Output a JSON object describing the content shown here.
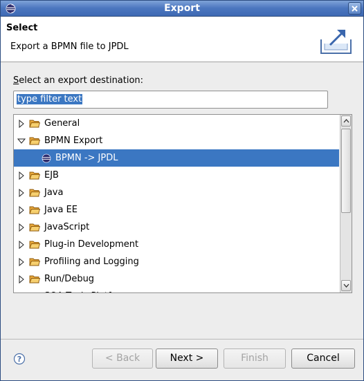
{
  "window": {
    "title": "Export"
  },
  "header": {
    "title": "Select",
    "description": "Export a BPMN file to JPDL"
  },
  "filter": {
    "label_prefix": "S",
    "label_rest": "elect an export destination:",
    "value": "type filter text"
  },
  "tree": {
    "items": [
      {
        "label": "General",
        "expanded": false,
        "icon": "folder-icon"
      },
      {
        "label": "BPMN Export",
        "expanded": true,
        "icon": "folder-open-icon"
      },
      {
        "label": "BPMN -> JPDL",
        "selected": true,
        "icon": "eclipse-icon"
      },
      {
        "label": "EJB",
        "expanded": false,
        "icon": "folder-icon"
      },
      {
        "label": "Java",
        "expanded": false,
        "icon": "folder-icon"
      },
      {
        "label": "Java EE",
        "expanded": false,
        "icon": "folder-icon"
      },
      {
        "label": "JavaScript",
        "expanded": false,
        "icon": "folder-icon"
      },
      {
        "label": "Plug-in Development",
        "expanded": false,
        "icon": "folder-icon"
      },
      {
        "label": "Profiling and Logging",
        "expanded": false,
        "icon": "folder-icon"
      },
      {
        "label": "Run/Debug",
        "expanded": false,
        "icon": "folder-icon"
      },
      {
        "label": "SOA Tools Platform",
        "expanded": false,
        "icon": "folder-icon"
      }
    ]
  },
  "buttons": {
    "back": "< Back",
    "next": "Next >",
    "finish": "Finish",
    "cancel": "Cancel"
  },
  "colors": {
    "selection": "#3b77c2",
    "titlebar": "#4b76bf"
  }
}
